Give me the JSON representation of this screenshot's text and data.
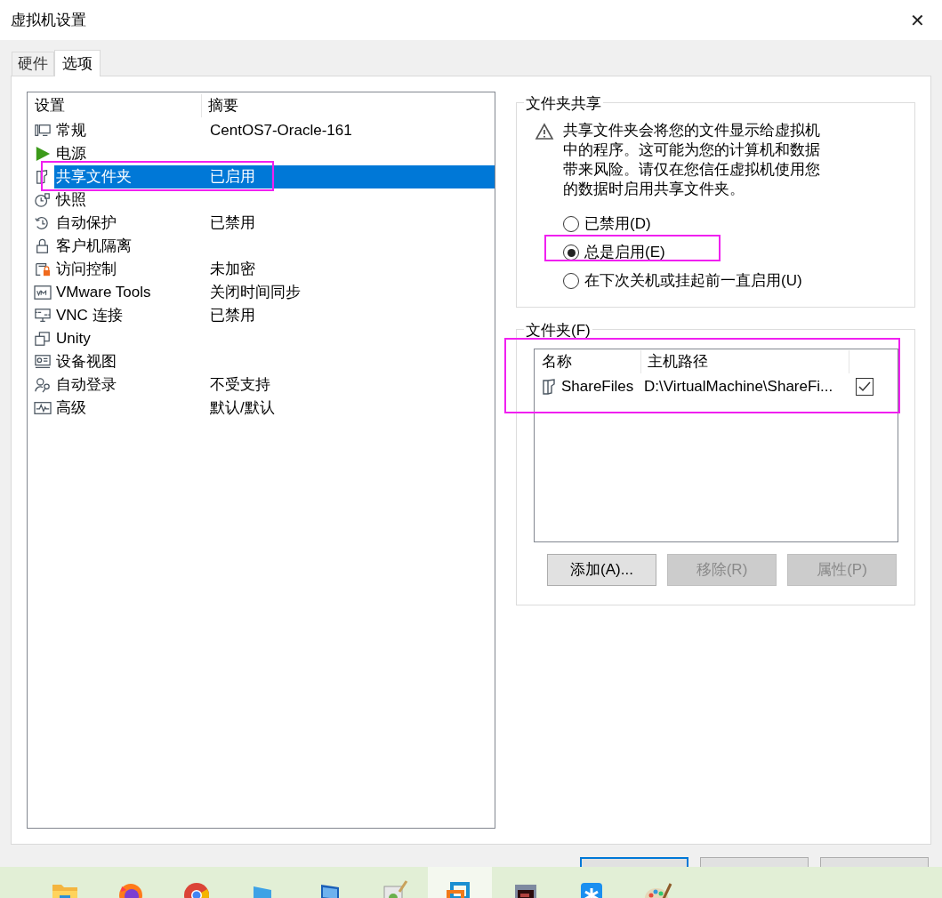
{
  "window": {
    "title": "虚拟机设置",
    "close": "✕"
  },
  "tabs": [
    {
      "label": "硬件",
      "selected": false
    },
    {
      "label": "选项",
      "selected": true
    }
  ],
  "settings_list": {
    "columns": [
      "设置",
      "摘要"
    ],
    "rows": [
      {
        "kind": "monitor",
        "name": "常规",
        "summary": "CentOS7-Oracle-161",
        "selected": false
      },
      {
        "kind": "play",
        "name": "电源",
        "selected": false
      },
      {
        "kind": "folder",
        "name": "共享文件夹",
        "summary": "已启用",
        "selected": true
      },
      {
        "kind": "snapshot",
        "name": "快照",
        "selected": false
      },
      {
        "kind": "clock",
        "name": "自动保护",
        "summary": "已禁用",
        "selected": false
      },
      {
        "kind": "lock",
        "name": "客户机隔离",
        "selected": false
      },
      {
        "kind": "access",
        "name": "访问控制",
        "summary": "未加密",
        "selected": false
      },
      {
        "kind": "vm",
        "name": "VMware Tools",
        "summary": "关闭时间同步",
        "selected": false
      },
      {
        "kind": "vnc",
        "name": "VNC 连接",
        "summary": "已禁用",
        "selected": false
      },
      {
        "kind": "unity",
        "name": "Unity",
        "selected": false
      },
      {
        "kind": "device",
        "name": "设备视图",
        "selected": false
      },
      {
        "kind": "login",
        "name": "自动登录",
        "summary": "不受支持",
        "selected": false
      },
      {
        "kind": "wave",
        "name": "高级",
        "summary": "默认/默认",
        "selected": false
      }
    ]
  },
  "folder_sharing": {
    "title": "文件夹共享",
    "warning": "共享文件夹会将您的文件显示给虚拟机中的程序。这可能为您的计算机和数据带来风险。请仅在您信任虚拟机使用您的数据时启用共享文件夹。",
    "options": [
      {
        "label": "已禁用(D)",
        "selected": false
      },
      {
        "label": "总是启用(E)",
        "selected": true
      },
      {
        "label": "在下次关机或挂起前一直启用(U)",
        "selected": false
      }
    ]
  },
  "folders": {
    "title": "文件夹(F)",
    "columns": [
      "名称",
      "主机路径"
    ],
    "rows": [
      {
        "name": "ShareFiles",
        "path": "D:\\VirtualMachine\\ShareFi...",
        "checked": true
      }
    ],
    "buttons": [
      {
        "label": "添加(A)...",
        "disabled": false
      },
      {
        "label": "移除(R)",
        "disabled": true
      },
      {
        "label": "属性(P)",
        "disabled": true
      }
    ]
  },
  "dialog_buttons": [
    {
      "kind": "default"
    },
    {
      "kind": "normal"
    },
    {
      "kind": "normal"
    }
  ],
  "taskbar": {
    "apps": [
      {
        "kind": "folder",
        "selected": false
      },
      {
        "kind": "firefox",
        "selected": false
      },
      {
        "kind": "chrome",
        "selected": false
      },
      {
        "kind": "monitor",
        "selected": false
      },
      {
        "kind": "window",
        "selected": false
      },
      {
        "kind": "notepad",
        "selected": false
      },
      {
        "kind": "vmware",
        "selected": true
      },
      {
        "kind": "screen",
        "selected": false
      },
      {
        "kind": "asterisk",
        "selected": false
      },
      {
        "kind": "palette",
        "selected": false
      }
    ]
  }
}
